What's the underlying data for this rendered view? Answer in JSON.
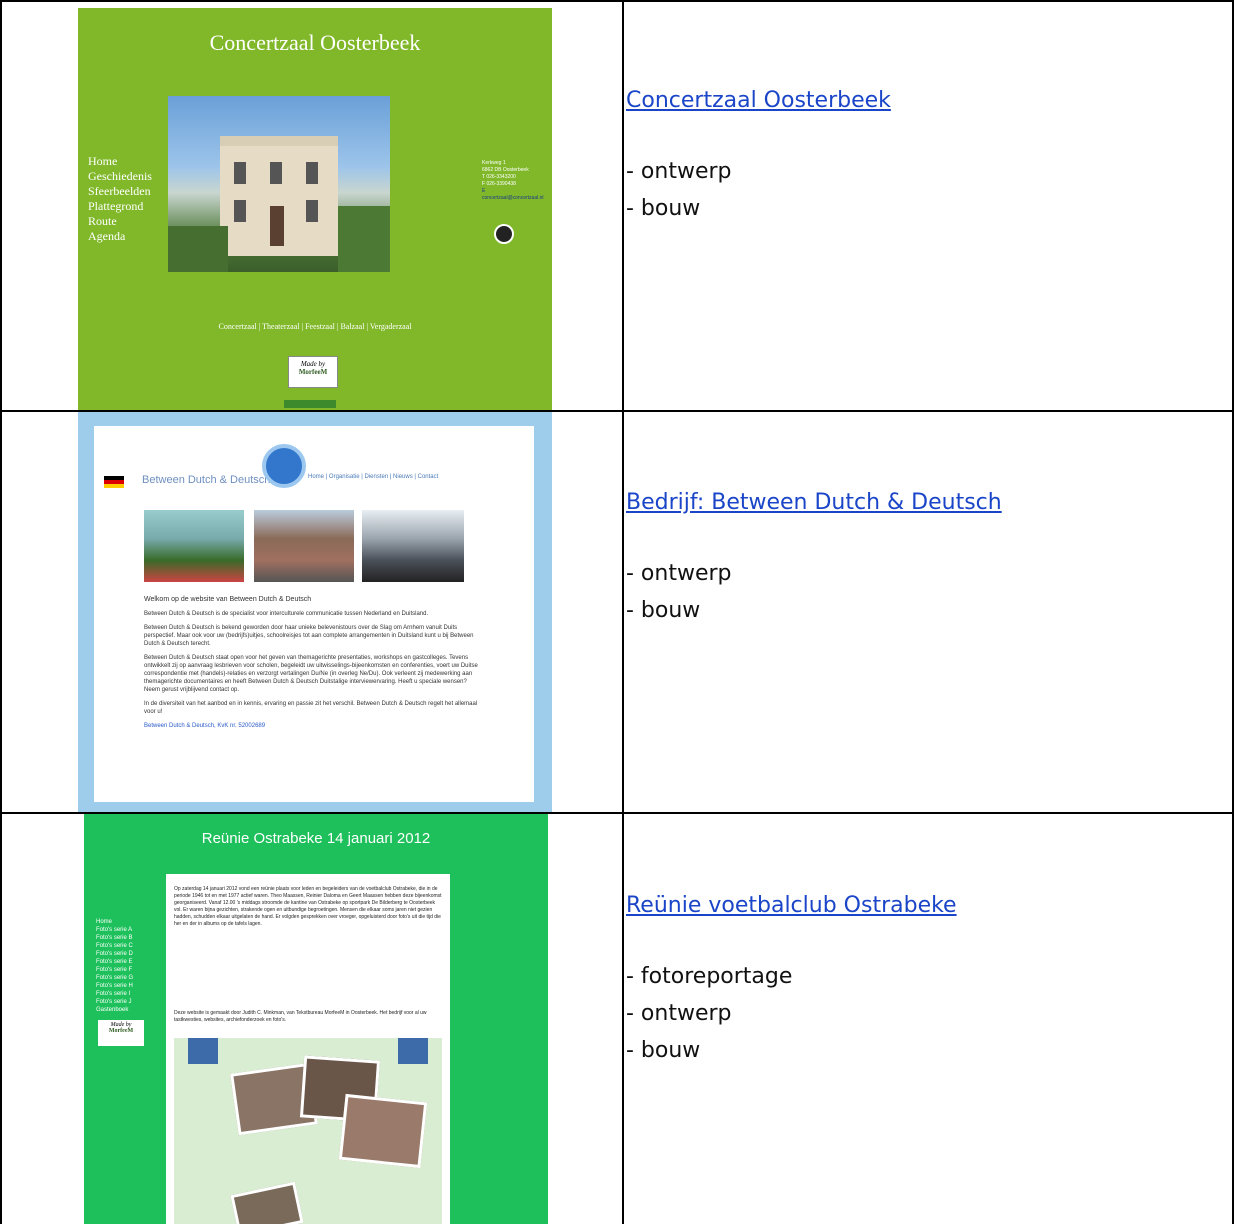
{
  "rows": [
    {
      "link": "Concertzaal Oosterbeek",
      "items": [
        "- ontwerp",
        "- bouw"
      ],
      "thumb": {
        "title": "Concertzaal Oosterbeek",
        "menu": [
          "Home",
          "Geschiedenis",
          "Sfeerbeelden",
          "Plattegrond",
          "Route",
          "Agenda"
        ],
        "address": [
          "Kerkweg 1",
          "6862 DB Oosterbeek",
          "T 026-3343200",
          "F 026-3390438",
          "E concertzaal@concertzaal.nl"
        ],
        "footer": "Concertzaal | Theaterzaal | Feestzaal | Balzaal | Vergaderzaal",
        "made_by": "Made by",
        "brand": "MorfeeM"
      }
    },
    {
      "link": "Bedrijf: Between Dutch & Deutsch",
      "items": [
        "- ontwerp",
        "- bouw"
      ],
      "thumb": {
        "logo": "Between Dutch & Deutsch",
        "nav": "Home | Organisatie | Diensten | Nieuws | Contact",
        "welcome": "Welkom op de website van Between Dutch & Deutsch",
        "paragraphs": [
          "Between Dutch & Deutsch is de specialist voor interculturele communicatie tussen Nederland en Duitsland.",
          "Between Dutch & Deutsch is bekend geworden door haar unieke belevenistours over de Slag om Arnhem vanuit Duits perspectief. Maar ook voor uw (bedrijfs)uitjes, schoolreisjes tot aan complete arrangementen in Duitsland kunt u bij Between Dutch & Deutsch terecht.",
          "Between Dutch & Deutsch staat open voor het geven van themagerichte presentaties, workshops en gastcolleges. Tevens ontwikkelt zij op aanvraag lesbrieven voor scholen, begeleidt uw uitwisselings-bijeenkomsten en conferenties, voert uw Duitse correspondentie met (handels)-relaties en verzorgt vertalingen Du/Ne (in overleg Ne/Du). Ook verleent zij medewerking aan themagerichte documentaires en heeft Between Dutch & Deutsch Duitstalige interviewervaring. Heeft u speciale wensen? Neem gerust vrijblijvend contact op.",
          "In de diversiteit van het aanbod en in kennis, ervaring en passie zit het verschil. Between Dutch & Deutsch regelt het allemaal voor u!"
        ],
        "kvk": "Between Dutch & Deutsch, KvK nr. 52002689"
      }
    },
    {
      "link": "Reünie voetbalclub Ostrabeke",
      "items": [
        "- fotoreportage",
        "- ontwerp",
        "- bouw"
      ],
      "thumb": {
        "title": "Reünie Ostrabeke 14 januari 2012",
        "menu": [
          "Home",
          "Foto's serie A",
          "Foto's serie B",
          "Foto's serie C",
          "Foto's serie D",
          "Foto's serie E",
          "Foto's serie F",
          "Foto's serie G",
          "Foto's serie H",
          "Foto's serie I",
          "Foto's serie J",
          "Gastenboek"
        ],
        "made_by": "Made by",
        "brand": "MorfeeM",
        "body": "Op zaterdag 14 januari 2012 vond een reünie plaats voor leden en begeleiders van de voetbalclub Ostrabeke, die in de periode 1946 tot en met 1977 actief waren. Theo Maassen, Reinier Daloma en Geert Maassen hebben deze bijeenkomst georganiseerd. Vanaf 12.00 's middags stroomde de kantine van Ostrabeke op sportpark De Bilderberg te Oosterbeek vol. Er waren bijna gezichten, strakende ogen en uitbundige begroetingen. Mensen die elkaar soms jaren niet gezien hadden, schudden elkaar uitgelaten de hand. Er volgden gesprekken over vroeger, opgeluisterd door foto's uit die tijd die her en der in albums op de tafels lagen.",
        "credit": "Deze website is gemaakt door Judith C. Minkman, van Tekstbureau MorfeeM in Oosterbeek. Het bedrijf voor al uw tastkwesties, websites, archiefonderzoek en foto's."
      }
    }
  ]
}
